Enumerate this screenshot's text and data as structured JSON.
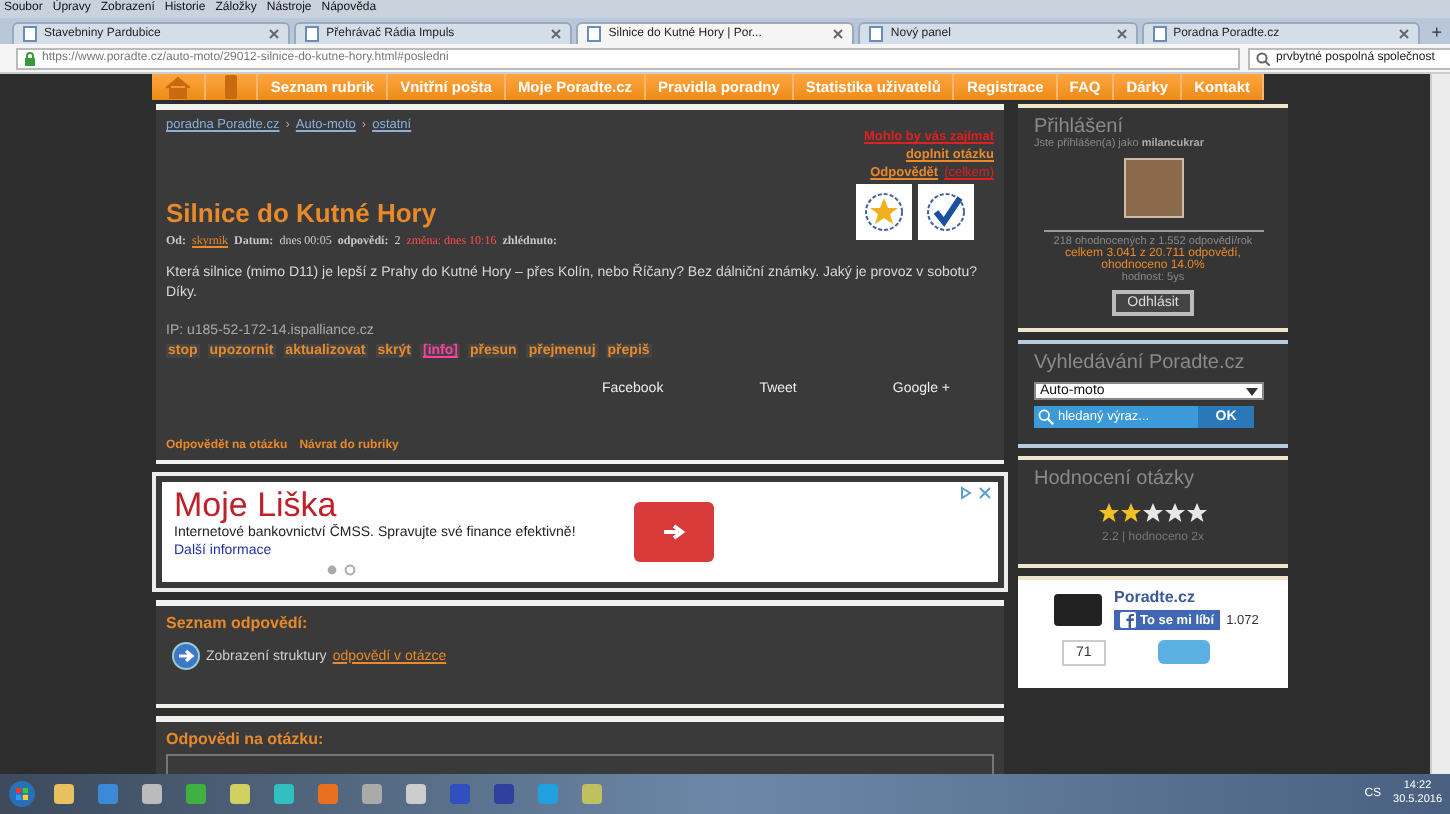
{
  "browser": {
    "menu": [
      "Soubor",
      "Úpravy",
      "Zobrazení",
      "Historie",
      "Záložky",
      "Nástroje",
      "Nápověda"
    ],
    "tabs": [
      {
        "title": "Stavebniny Pardubice",
        "selected": false
      },
      {
        "title": "Přehrávač Rádia Impuls",
        "selected": false
      },
      {
        "title": "Silnice do Kutné Hory | Por...",
        "selected": true
      },
      {
        "title": "Nový panel",
        "selected": false
      },
      {
        "title": "Poradna Poradte.cz",
        "selected": false
      }
    ],
    "new_tab": "+",
    "url": "https://www.poradte.cz/auto-moto/29012-silnice-do-kutne-hory.html#posledni",
    "search": "prvbytné pospolná společnost"
  },
  "nav": {
    "items": [
      "Seznam rubrik",
      "Vnitřní pošta",
      "Moje Poradte.cz",
      "Pravidla poradny",
      "Statistika uživatelů",
      "Registrace",
      "FAQ",
      "Dárky",
      "Kontakt"
    ]
  },
  "question": {
    "breadcrumb": [
      {
        "text": "poradna Poradte.cz",
        "sep": "›"
      },
      {
        "text": "Auto-moto",
        "sep": "›"
      },
      {
        "text": "ostatní"
      }
    ],
    "top_link": "Mohlo by vás zajímat",
    "add_link": "doplnit otázku",
    "answer_link": "Odpovědět",
    "answer_note": "(celkem)",
    "title": "Silnice do Kutné Hory",
    "meta": [
      {
        "kind": "label",
        "text": "Od:"
      },
      {
        "kind": "link",
        "text": "skyrnik"
      },
      {
        "kind": "label",
        "text": "Datum:"
      },
      {
        "kind": "value",
        "text": "dnes 00:05"
      },
      {
        "kind": "label",
        "text": "odpovědí:"
      },
      {
        "kind": "value",
        "text": "2"
      },
      {
        "kind": "alert",
        "text": "změna: dnes 10:16"
      },
      {
        "kind": "label",
        "text": "zhlédnuto:"
      }
    ],
    "text": "Která silnice (mimo D11) je lepší z Prahy do Kutné Hory – přes Kolín, nebo Říčany? Bez dálniční známky. Jaký je provoz v sobotu? Díky.",
    "ip": "IP: u185-52-172-14.ispalliance.cz",
    "actions": [
      {
        "text": "stop",
        "kind": "normal"
      },
      {
        "text": "upozornit",
        "kind": "normal"
      },
      {
        "text": "aktualizovat",
        "kind": "normal"
      },
      {
        "text": "skrýt",
        "kind": "normal"
      },
      {
        "text": "[info]",
        "kind": "info"
      },
      {
        "text": "přesun",
        "kind": "normal"
      },
      {
        "text": "přejmenuj",
        "kind": "normal"
      },
      {
        "text": "přepiš",
        "kind": "normal"
      }
    ],
    "share": [
      "Facebook",
      "Tweet",
      "Google +"
    ],
    "footer": [
      "Odpovědět na otázku",
      "Návrat do rubriky"
    ]
  },
  "ad": {
    "title": "Moje Liška",
    "text": "Internetové bankovnictví ČMSS. Spravujte své finance efektivně!",
    "link": "Další informace"
  },
  "answers_list": {
    "heading": "Seznam odpovědí:",
    "text": "Zobrazení struktury",
    "link": "odpovědí v otázce"
  },
  "answers": {
    "heading": "Odpovědi na otázku:"
  },
  "login": {
    "heading": "Přihlášení",
    "intro": "Jste přihlášen(a) jako",
    "user": "milancukrar",
    "stats": "218 ohodnocených z 1.552 odpovědí/rok",
    "total": "celkem 3.041 z 20.711 odpovědí,",
    "rated": "ohodnoceno 14.0%",
    "rank": "hodnost: 5ys",
    "button": "Odhlásit"
  },
  "search": {
    "heading": "Vyhledávání Poradte.cz",
    "category": "Auto-moto",
    "placeholder": "hledaný výraz...",
    "button": "OK"
  },
  "rating": {
    "heading": "Hodnocení otázky",
    "stars": 2,
    "summary": "2.2 | hodnoceno 2x"
  },
  "facebook": {
    "page": "Poradte.cz",
    "like": "To se mi líbí",
    "count": "1.072",
    "counter": "71"
  },
  "taskbar": {
    "lang": "CS",
    "time": "14:22",
    "date": "30.5.2016"
  }
}
